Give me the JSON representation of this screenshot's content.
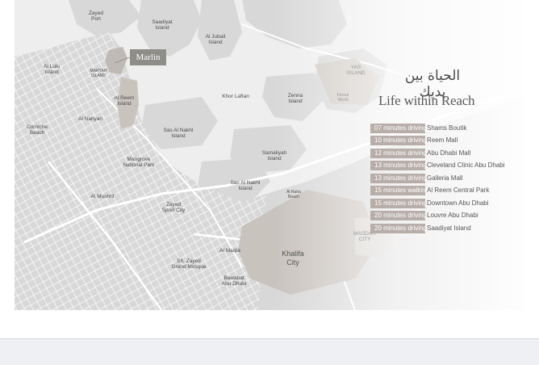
{
  "map": {
    "labels": [
      {
        "id": "zayed-port",
        "text": "Zayed\nPort"
      },
      {
        "id": "saadiyat-island",
        "text": "Saadiyat\nIsland"
      },
      {
        "id": "al-jubail-island",
        "text": "Al Jubail\nIsland"
      },
      {
        "id": "yas-island",
        "text": "YAS\nISLAND"
      },
      {
        "id": "al-lulu-island",
        "text": "Al Lulu\nIsland"
      },
      {
        "id": "maryah-island",
        "text": "MARYAH\nISLAND"
      },
      {
        "id": "al-reem-island",
        "text": "Al Reem\nIsland"
      },
      {
        "id": "khor-laftan",
        "text": "Khor Laftan"
      },
      {
        "id": "zenna-island",
        "text": "Zenna\nIsland"
      },
      {
        "id": "ferrari-world",
        "text": "Ferrari\nWorld"
      },
      {
        "id": "corniche-beach",
        "text": "Corniche\nBeach"
      },
      {
        "id": "al-nahyan",
        "text": "Al Nahyan"
      },
      {
        "id": "sas-al-nakhl-island-1",
        "text": "Sas Al Nakhl\nIsland"
      },
      {
        "id": "mangrove-national-park",
        "text": "Mangrove\nNational Park"
      },
      {
        "id": "samaliyah-island",
        "text": "Samaliyah\nIsland"
      },
      {
        "id": "sas-al-nakhl-island-2",
        "text": "Sas Al Nakhl\nIsland"
      },
      {
        "id": "al-mushrif",
        "text": "Al Mushrif"
      },
      {
        "id": "al-raha-beach",
        "text": "Al Raha\nBeach"
      },
      {
        "id": "zayed-sport-city",
        "text": "Zayed\nSport City"
      },
      {
        "id": "masdar-city",
        "text": "MASDAR\nCITY"
      },
      {
        "id": "al-maqta",
        "text": "Al Maqta"
      },
      {
        "id": "khalifa-city",
        "text": "Khalifa\nCity"
      },
      {
        "id": "sh-zayed-grand-mosque",
        "text": "Sh. Zayed\nGrand Mosque"
      },
      {
        "id": "bawabat-abu-dhabi",
        "text": "Bawabat\nAbu Dhabi"
      }
    ],
    "marker_label": "Marlin"
  },
  "tagline": {
    "arabic": "الحياة بين يديك",
    "english": "Life within Reach"
  },
  "distances": [
    {
      "time": "07 minutes driving to",
      "destination": "Shams Boutik"
    },
    {
      "time": "10 minutes driving to",
      "destination": "Reem Mall"
    },
    {
      "time": "12 minutes driving to",
      "destination": "Abu Dhabi Mall"
    },
    {
      "time": "13 minutes driving to",
      "destination": "Cleveland Clinic Abu Dhabi"
    },
    {
      "time": "13 minutes driving to",
      "destination": "Galleria Mall"
    },
    {
      "time": "15 minutes walking to",
      "destination": "Al Reem Central Park"
    },
    {
      "time": "15 minutes driving to",
      "destination": "Downtown Abu Dhabi"
    },
    {
      "time": "20 minutes driving to",
      "destination": "Louvre Abu Dhabi"
    },
    {
      "time": "20 minutes driving to",
      "destination": "Saadiyat Island"
    }
  ],
  "colors": {
    "land": "#dcdcdc",
    "water": "#f2f2f2",
    "road": "#ffffff",
    "highlight": "#cbc5c0",
    "marker": "#8f8d88",
    "time_badge": "#b8aea9"
  }
}
